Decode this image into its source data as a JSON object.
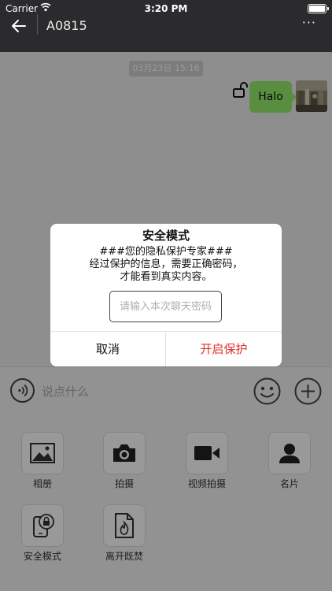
{
  "status_bar": {
    "carrier": "Carrier",
    "time": "3:20 PM"
  },
  "nav": {
    "title": "A0815",
    "more": "···"
  },
  "chat": {
    "timestamp": "03月23日 15:16",
    "message": "Halo"
  },
  "input_bar": {
    "placeholder": "说点什么"
  },
  "tools": [
    {
      "label": "相册",
      "icon": "image-icon"
    },
    {
      "label": "拍摄",
      "icon": "camera-icon"
    },
    {
      "label": "视频拍摄",
      "icon": "video-camera-icon"
    },
    {
      "label": "名片",
      "icon": "contact-card-icon"
    },
    {
      "label": "安全模式",
      "icon": "secure-phone-icon"
    },
    {
      "label": "离开既焚",
      "icon": "burn-file-icon"
    }
  ],
  "dialog": {
    "title": "安全模式",
    "line1": "###您的隐私保护专家###",
    "line2": "经过保护的信息，需要正确密码，",
    "line3": "才能看到真实内容。",
    "password_placeholder": "请输入本次聊天密码",
    "cancel_label": "取消",
    "confirm_label": "开启保护"
  },
  "colors": {
    "accent_red": "#e0312a",
    "bubble_green": "#95ec69",
    "nav_bar": "#2b2b2d"
  }
}
